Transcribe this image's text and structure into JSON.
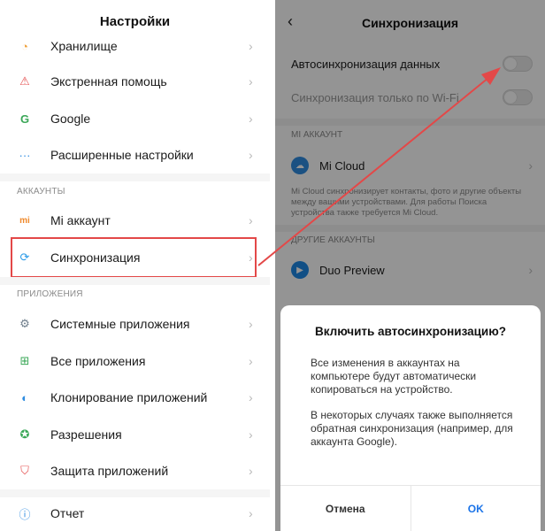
{
  "left": {
    "title": "Настройки",
    "items_top": [
      {
        "label": "Хранилище",
        "icon": "storage-icon",
        "color": "#f0a23c"
      },
      {
        "label": "Экстренная помощь",
        "icon": "warning-icon",
        "color": "#e55252"
      },
      {
        "label": "Google",
        "icon": "google-icon",
        "color": "#3aa757"
      },
      {
        "label": "Расширенные настройки",
        "icon": "more-dots-icon",
        "color": "#2f8ce0"
      }
    ],
    "section_accounts": "АККАУНТЫ",
    "items_accounts": [
      {
        "label": "Mi аккаунт",
        "icon": "mi-icon",
        "color": "#f08a2c"
      },
      {
        "label": "Синхронизация",
        "icon": "sync-icon",
        "color": "#2b9be8"
      }
    ],
    "section_apps": "ПРИЛОЖЕНИЯ",
    "items_apps": [
      {
        "label": "Системные приложения",
        "icon": "gear-icon",
        "color": "#6f7e8c"
      },
      {
        "label": "Все приложения",
        "icon": "grid-icon",
        "color": "#3aa757"
      },
      {
        "label": "Клонирование приложений",
        "icon": "clone-icon",
        "color": "#2f8ce0"
      },
      {
        "label": "Разрешения",
        "icon": "permissions-icon",
        "color": "#3aa757"
      },
      {
        "label": "Защита приложений",
        "icon": "shield-icon",
        "color": "#e55252"
      }
    ],
    "items_bottom": [
      {
        "label": "Отчет",
        "icon": "question-icon",
        "color": "#2f8ce0"
      }
    ]
  },
  "right": {
    "title": "Синхронизация",
    "auto_sync": "Автосинхронизация данных",
    "wifi_only": "Синхронизация только по Wi-Fi",
    "section_mi": "MI АККАУНТ",
    "mi_cloud": "Mi Cloud",
    "mi_note": "Mi Cloud синхронизирует контакты, фото и другие объекты между вашими устройствами. Для работы Поиска устройства также требуется Mi Cloud.",
    "section_other": "ДРУГИЕ АККАУНТЫ",
    "duo": "Duo Preview"
  },
  "dialog": {
    "title": "Включить автосинхронизацию?",
    "para1": "Все изменения в аккаунтах на компьютере будут автоматически копироваться на устройство.",
    "para2": "В некоторых случаях также выполняется обратная синхронизация (например, для аккаунта Google).",
    "cancel": "Отмена",
    "ok": "OK"
  },
  "colors": {
    "highlight": "#e34848",
    "accent": "#1a73e8",
    "mi_cloud": "#2f8ce0",
    "duo": "#1e88e5"
  }
}
